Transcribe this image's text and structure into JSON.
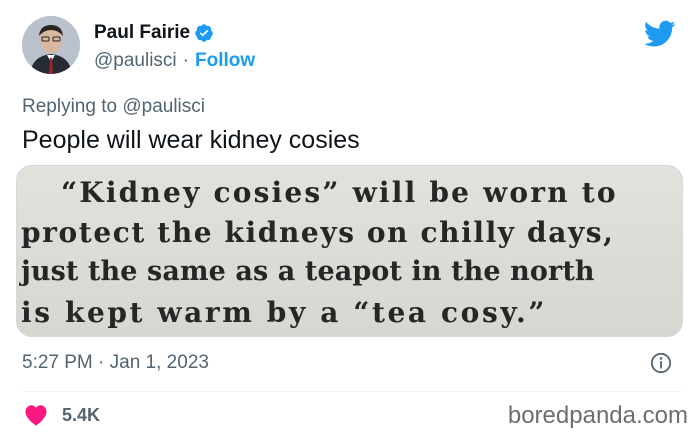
{
  "author": {
    "display_name": "Paul Fairie",
    "handle": "@paulisci",
    "separator": "·",
    "follow_label": "Follow"
  },
  "replying_to": "Replying to @paulisci",
  "tweet_text": "People will wear kidney cosies",
  "clipping": {
    "lines": [
      "“Kidney cosies” will be  worn to",
      "protect the kidneys on chilly days,",
      "just the same as a teapot in the north",
      "is kept warm by a “tea cosy.”"
    ]
  },
  "meta": {
    "timestamp": "5:27 PM · Jan 1, 2023"
  },
  "engagement": {
    "likes": "5.4K"
  },
  "watermark": "boredpanda.com",
  "colors": {
    "accent": "#1d9bf0",
    "like": "#f91880",
    "secondary_text": "#536471"
  },
  "icons": {
    "verified": "verified-badge-icon",
    "brand": "twitter-bird-icon",
    "info": "info-icon",
    "like": "heart-icon"
  }
}
